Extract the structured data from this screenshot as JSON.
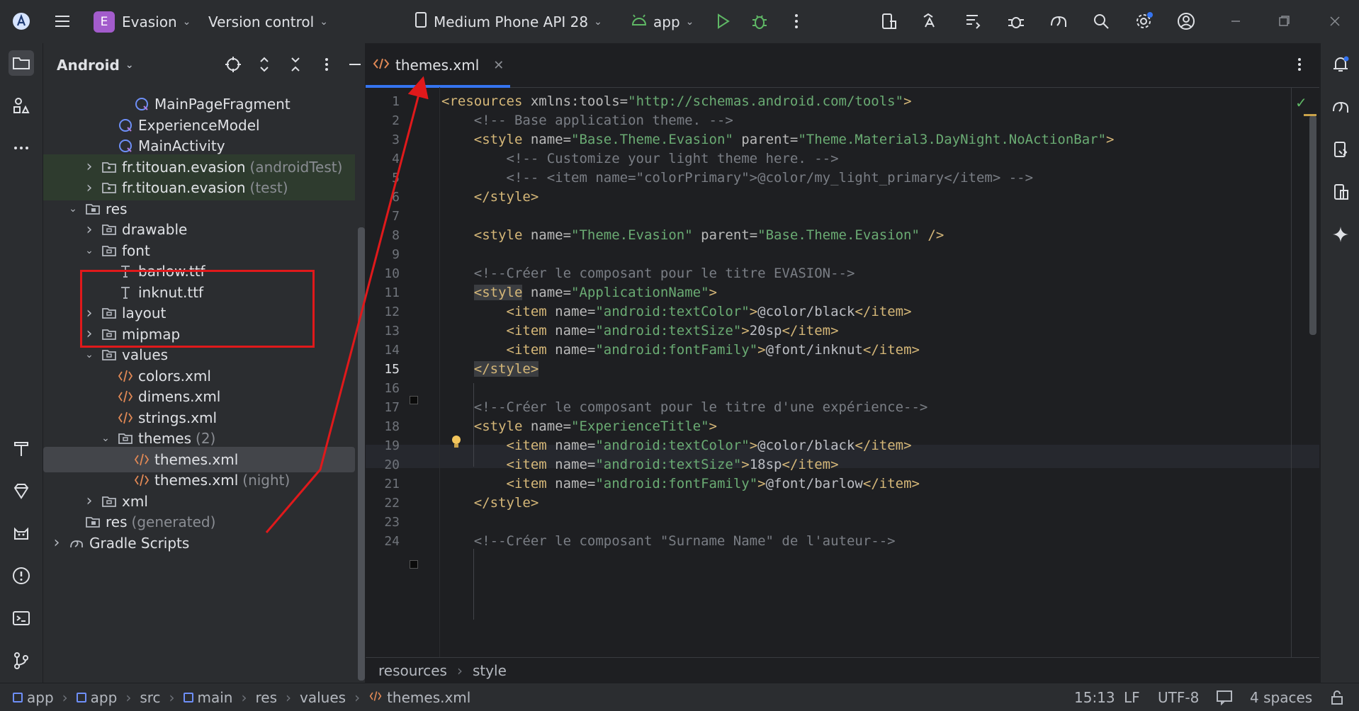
{
  "titlebar": {
    "project_badge": "E",
    "project_name": "Evasion",
    "vcs": "Version control",
    "device": "Medium Phone API 28",
    "run_config": "app",
    "colors": {
      "badge": "#a35ccc",
      "run": "#5fb865",
      "debug": "#5fb865"
    }
  },
  "project_panel": {
    "view_mode": "Android",
    "tree": [
      {
        "label": "MainPageFragment",
        "icon": "kotlin-class-icon",
        "indent": 5,
        "arrow": ""
      },
      {
        "label": "ExperienceModel",
        "icon": "kotlin-class-icon",
        "indent": 4,
        "arrow": ""
      },
      {
        "label": "MainActivity",
        "icon": "kotlin-class-icon",
        "indent": 4,
        "arrow": ""
      },
      {
        "label": "fr.titouan.evasion",
        "suffix": "(androidTest)",
        "icon": "package-icon",
        "indent": 3,
        "arrow": "right",
        "green": true
      },
      {
        "label": "fr.titouan.evasion",
        "suffix": "(test)",
        "icon": "package-icon",
        "indent": 3,
        "arrow": "right",
        "green": true
      },
      {
        "label": "res",
        "icon": "res-folder-icon",
        "indent": 2,
        "arrow": "down"
      },
      {
        "label": "drawable",
        "icon": "folder-icon",
        "indent": 3,
        "arrow": "right"
      },
      {
        "label": "font",
        "icon": "folder-icon",
        "indent": 3,
        "arrow": "down"
      },
      {
        "label": "barlow.ttf",
        "icon": "font-file-icon",
        "indent": 4,
        "arrow": ""
      },
      {
        "label": "inknut.ttf",
        "icon": "font-file-icon",
        "indent": 4,
        "arrow": ""
      },
      {
        "label": "layout",
        "icon": "folder-icon",
        "indent": 3,
        "arrow": "right"
      },
      {
        "label": "mipmap",
        "icon": "folder-icon",
        "indent": 3,
        "arrow": "right"
      },
      {
        "label": "values",
        "icon": "folder-icon",
        "indent": 3,
        "arrow": "down"
      },
      {
        "label": "colors.xml",
        "icon": "xml-file-icon",
        "indent": 4,
        "arrow": ""
      },
      {
        "label": "dimens.xml",
        "icon": "xml-file-icon",
        "indent": 4,
        "arrow": ""
      },
      {
        "label": "strings.xml",
        "icon": "xml-file-icon",
        "indent": 4,
        "arrow": ""
      },
      {
        "label": "themes",
        "suffix": "(2)",
        "icon": "folder-icon",
        "indent": 4,
        "arrow": "down"
      },
      {
        "label": "themes.xml",
        "icon": "xml-file-icon",
        "indent": 5,
        "arrow": "",
        "selected": true
      },
      {
        "label": "themes.xml",
        "suffix": "(night)",
        "icon": "xml-file-icon",
        "indent": 5,
        "arrow": ""
      },
      {
        "label": "xml",
        "icon": "folder-icon",
        "indent": 3,
        "arrow": "right"
      },
      {
        "label": "res",
        "suffix": "(generated)",
        "icon": "res-folder-icon",
        "indent": 2,
        "arrow": ""
      },
      {
        "label": "Gradle Scripts",
        "icon": "gradle-icon",
        "indent": 1,
        "arrow": "right"
      }
    ]
  },
  "editor": {
    "tab_label": "themes.xml",
    "current_line": 15,
    "lines": [
      {
        "n": "1",
        "segs": [
          [
            "tag",
            "<resources "
          ],
          [
            "attr",
            "xmlns:tools="
          ],
          [
            "val",
            "\"http://schemas.android.com/tools\""
          ],
          [
            "tag",
            ">"
          ]
        ]
      },
      {
        "n": "2",
        "segs": [
          [
            "cm",
            "    <!-- Base application theme. -->"
          ]
        ]
      },
      {
        "n": "3",
        "segs": [
          [
            "tag",
            "    <style "
          ],
          [
            "attr",
            "name="
          ],
          [
            "val",
            "\"Base.Theme.Evasion\" "
          ],
          [
            "attr",
            "parent="
          ],
          [
            "val",
            "\"Theme.Material3.DayNight.NoActionBar\""
          ],
          [
            "tag",
            ">"
          ]
        ]
      },
      {
        "n": "4",
        "segs": [
          [
            "cm",
            "        <!-- Customize your light theme here. -->"
          ]
        ]
      },
      {
        "n": "5",
        "segs": [
          [
            "cm",
            "        <!-- <item name=\"colorPrimary\">@color/my_light_primary</item> -->"
          ]
        ]
      },
      {
        "n": "6",
        "segs": [
          [
            "tag",
            "    </style>"
          ]
        ]
      },
      {
        "n": "7",
        "segs": []
      },
      {
        "n": "8",
        "segs": [
          [
            "tag",
            "    <style "
          ],
          [
            "attr",
            "name="
          ],
          [
            "val",
            "\"Theme.Evasion\" "
          ],
          [
            "attr",
            "parent="
          ],
          [
            "val",
            "\"Base.Theme.Evasion\" "
          ],
          [
            "tag",
            "/>"
          ]
        ]
      },
      {
        "n": "9",
        "segs": []
      },
      {
        "n": "10",
        "segs": [
          [
            "cm",
            "    <!--Créer le composant pour le titre EVASION-->"
          ]
        ]
      },
      {
        "n": "11",
        "segs": [
          [
            "tag",
            "    "
          ],
          [
            "hl",
            "<style"
          ],
          [
            "attr",
            " name="
          ],
          [
            "val",
            "\"ApplicationName\""
          ],
          [
            "tag",
            ">"
          ]
        ]
      },
      {
        "n": "12",
        "segs": [
          [
            "tag",
            "        <item "
          ],
          [
            "attr",
            "name="
          ],
          [
            "val",
            "\"android:textColor\""
          ],
          [
            "tag",
            ">"
          ],
          [
            "txt",
            "@color/black"
          ],
          [
            "tag",
            "</item>"
          ]
        ]
      },
      {
        "n": "13",
        "segs": [
          [
            "tag",
            "        <item "
          ],
          [
            "attr",
            "name="
          ],
          [
            "val",
            "\"android:textSize\""
          ],
          [
            "tag",
            ">"
          ],
          [
            "txt",
            "20sp"
          ],
          [
            "tag",
            "</item>"
          ]
        ]
      },
      {
        "n": "14",
        "segs": [
          [
            "tag",
            "        <item "
          ],
          [
            "attr",
            "name="
          ],
          [
            "val",
            "\"android:fontFamily\""
          ],
          [
            "tag",
            ">"
          ],
          [
            "txt",
            "@font/inknut"
          ],
          [
            "tag",
            "</item>"
          ]
        ]
      },
      {
        "n": "15",
        "segs": [
          [
            "tag",
            "    "
          ],
          [
            "hl",
            "</style>"
          ]
        ]
      },
      {
        "n": "16",
        "segs": []
      },
      {
        "n": "17",
        "segs": [
          [
            "cm",
            "    <!--Créer le composant pour le titre d'une expérience-->"
          ]
        ]
      },
      {
        "n": "18",
        "segs": [
          [
            "tag",
            "    <style "
          ],
          [
            "attr",
            "name="
          ],
          [
            "val",
            "\"ExperienceTitle\""
          ],
          [
            "tag",
            ">"
          ]
        ]
      },
      {
        "n": "19",
        "segs": [
          [
            "tag",
            "        <item "
          ],
          [
            "attr",
            "name="
          ],
          [
            "val",
            "\"android:textColor\""
          ],
          [
            "tag",
            ">"
          ],
          [
            "txt",
            "@color/black"
          ],
          [
            "tag",
            "</item>"
          ]
        ]
      },
      {
        "n": "20",
        "segs": [
          [
            "tag",
            "        <item "
          ],
          [
            "attr",
            "name="
          ],
          [
            "val",
            "\"android:textSize\""
          ],
          [
            "tag",
            ">"
          ],
          [
            "txt",
            "18sp"
          ],
          [
            "tag",
            "</item>"
          ]
        ]
      },
      {
        "n": "21",
        "segs": [
          [
            "tag",
            "        <item "
          ],
          [
            "attr",
            "name="
          ],
          [
            "val",
            "\"android:fontFamily\""
          ],
          [
            "tag",
            ">"
          ],
          [
            "txt",
            "@font/barlow"
          ],
          [
            "tag",
            "</item>"
          ]
        ]
      },
      {
        "n": "22",
        "segs": [
          [
            "tag",
            "    </style>"
          ]
        ]
      },
      {
        "n": "23",
        "segs": []
      },
      {
        "n": "24",
        "segs": [
          [
            "cm",
            "    <!--Créer le composant \"Surname Name\" de l'auteur-->"
          ]
        ]
      }
    ],
    "breadcrumb": [
      "resources",
      "style"
    ]
  },
  "statusbar": {
    "path": [
      "app",
      "app",
      "src",
      "main",
      "res",
      "values",
      "themes.xml"
    ],
    "position": "15:13",
    "line_ending": "LF",
    "encoding": "UTF-8",
    "indent": "4 spaces"
  }
}
